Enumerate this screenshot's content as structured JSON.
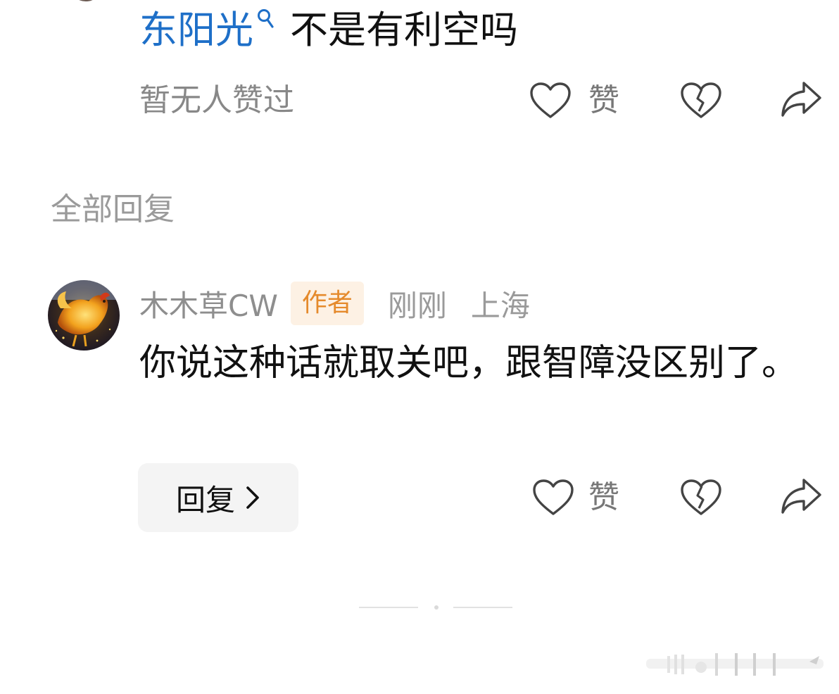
{
  "quoted_comment": {
    "topic_link": "东阳光",
    "topic_icon": "search-icon",
    "text": "不是有利空吗",
    "no_likes_text": "暂无人赞过",
    "like_label": "赞"
  },
  "section": {
    "title": "全部回复"
  },
  "reply": {
    "username": "木木草CW",
    "badge": "作者",
    "time": "刚刚",
    "location": "上海",
    "body": "你说这种话就取关吧，跟智障没区别了。",
    "reply_button_label": "回复",
    "like_label": "赞"
  },
  "colors": {
    "link": "#1e6fc8",
    "badge_text": "#e58a2c",
    "badge_bg": "#fdf1e4",
    "muted": "#8e8e8e"
  }
}
